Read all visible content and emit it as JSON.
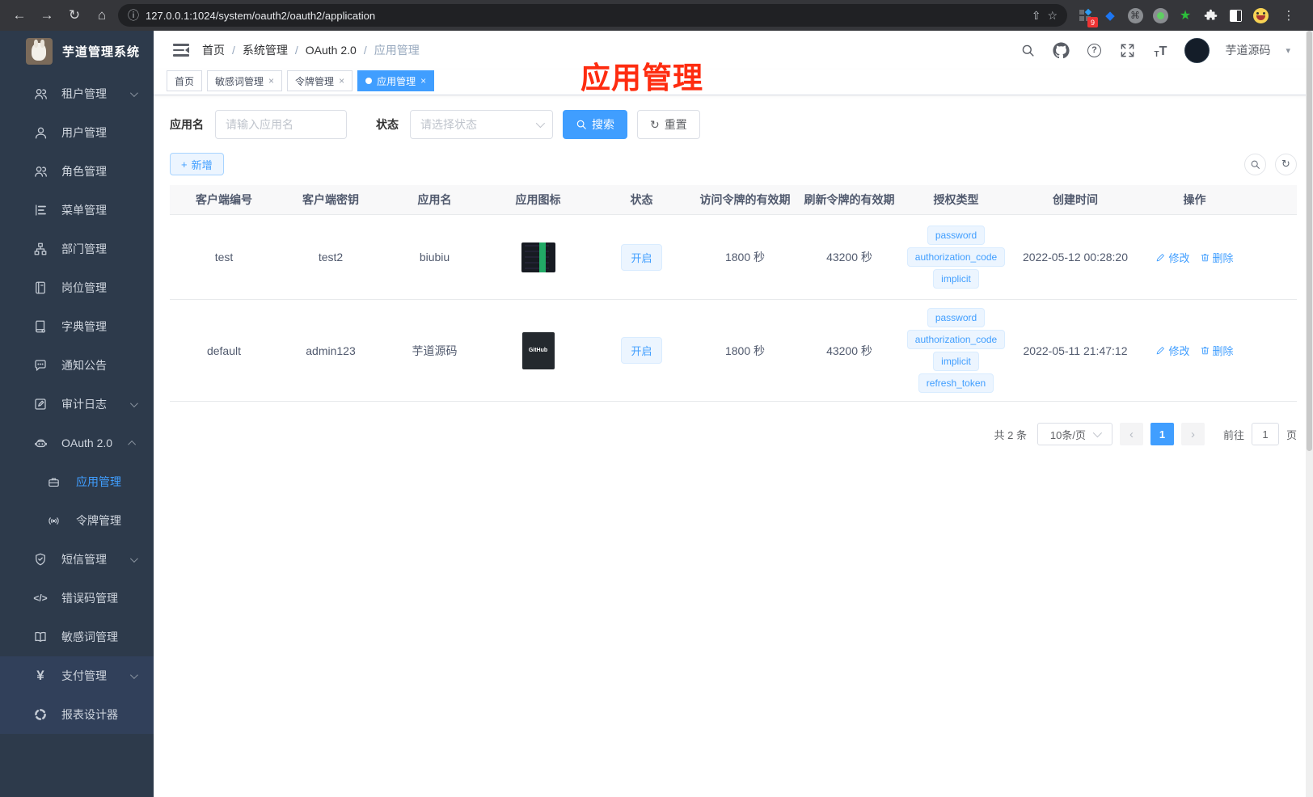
{
  "browser": {
    "url": "127.0.0.1:1024/system/oauth2/oauth2/application",
    "extension_badge": "9"
  },
  "icons": {
    "back": "←",
    "forward": "→",
    "reload": "↻",
    "home": "⌂",
    "info": "ⓘ",
    "share": "⇧",
    "star": "☆",
    "dots": "⋮",
    "gem": "◆",
    "command": "⌘",
    "ext_star": "★",
    "help": "?",
    "caret": "▾",
    "close": "×",
    "sep": "/",
    "pay": "¥",
    "errcode": "</>",
    "plus": "+",
    "refresh": "↻",
    "font_small": "T",
    "font_big": "T",
    "prev": "‹",
    "next": "›"
  },
  "sidebar": {
    "title": "芋道管理系统",
    "items": [
      {
        "label": "租户管理"
      },
      {
        "label": "用户管理"
      },
      {
        "label": "角色管理"
      },
      {
        "label": "菜单管理"
      },
      {
        "label": "部门管理"
      },
      {
        "label": "岗位管理"
      },
      {
        "label": "字典管理"
      },
      {
        "label": "通知公告"
      },
      {
        "label": "审计日志"
      },
      {
        "label": "OAuth 2.0"
      },
      {
        "label": "应用管理"
      },
      {
        "label": "令牌管理"
      },
      {
        "label": "短信管理"
      },
      {
        "label": "错误码管理"
      },
      {
        "label": "敏感词管理"
      },
      {
        "label": "支付管理"
      },
      {
        "label": "报表设计器"
      }
    ]
  },
  "header": {
    "breadcrumb": [
      "首页",
      "系统管理",
      "OAuth 2.0",
      "应用管理"
    ],
    "username": "芋道源码"
  },
  "tabs": [
    {
      "label": "首页"
    },
    {
      "label": "敏感词管理"
    },
    {
      "label": "令牌管理"
    },
    {
      "label": "应用管理"
    }
  ],
  "annotation": {
    "text": "应用管理",
    "color": "#fe2c10"
  },
  "filter": {
    "name_label": "应用名",
    "name_placeholder": "请输入应用名",
    "status_label": "状态",
    "status_placeholder": "请选择状态",
    "search_label": "搜索",
    "reset_label": "重置"
  },
  "toolbar": {
    "add_label": "新增"
  },
  "table": {
    "columns": [
      "客户端编号",
      "客户端密钥",
      "应用名",
      "应用图标",
      "状态",
      "访问令牌的有效期",
      "刷新令牌的有效期",
      "授权类型",
      "创建时间",
      "操作"
    ],
    "actions": {
      "edit": "修改",
      "delete": "删除"
    },
    "rows": [
      {
        "client_id": "test",
        "client_secret": "test2",
        "app_name": "biubiu",
        "status": "开启",
        "access_token_ttl": "1800 秒",
        "refresh_token_ttl": "43200 秒",
        "grant_types": [
          "password",
          "authorization_code",
          "implicit"
        ],
        "create_time": "2022-05-12 00:28:20"
      },
      {
        "client_id": "default",
        "client_secret": "admin123",
        "app_name": "芋道源码",
        "icon_label": "GitHub",
        "status": "开启",
        "access_token_ttl": "1800 秒",
        "refresh_token_ttl": "43200 秒",
        "grant_types": [
          "password",
          "authorization_code",
          "implicit",
          "refresh_token"
        ],
        "create_time": "2022-05-11 21:47:12"
      }
    ]
  },
  "pagination": {
    "total": "共 2 条",
    "page_size": "10条/页",
    "current_page": "1",
    "goto_label": "前往",
    "goto_value": "1",
    "page_unit": "页"
  },
  "colors": {
    "accent": "#409eff",
    "sidebar_bg": "#2d3a4b",
    "annotation": "#fe2c10"
  }
}
